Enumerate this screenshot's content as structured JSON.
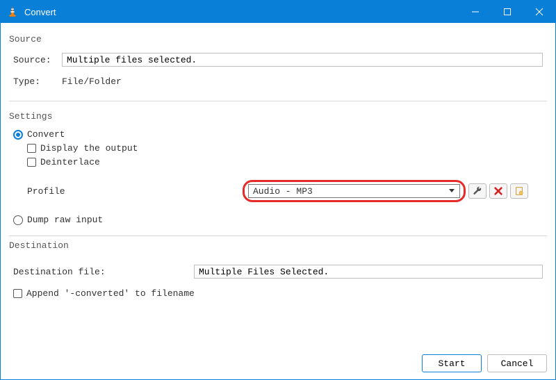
{
  "window": {
    "title": "Convert"
  },
  "source": {
    "section": "Source",
    "source_label": "Source:",
    "source_value": "Multiple files selected.",
    "type_label": "Type:",
    "type_value": "File/Folder"
  },
  "settings": {
    "section": "Settings",
    "convert_label": "Convert",
    "display_output_label": "Display the output",
    "deinterlace_label": "Deinterlace",
    "profile_label": "Profile",
    "profile_value": "Audio - MP3",
    "dump_raw_label": "Dump raw input"
  },
  "destination": {
    "section": "Destination",
    "file_label": "Destination file:",
    "file_value": "Multiple Files Selected.",
    "append_label": "Append '-converted' to filename"
  },
  "footer": {
    "start": "Start",
    "cancel": "Cancel"
  }
}
